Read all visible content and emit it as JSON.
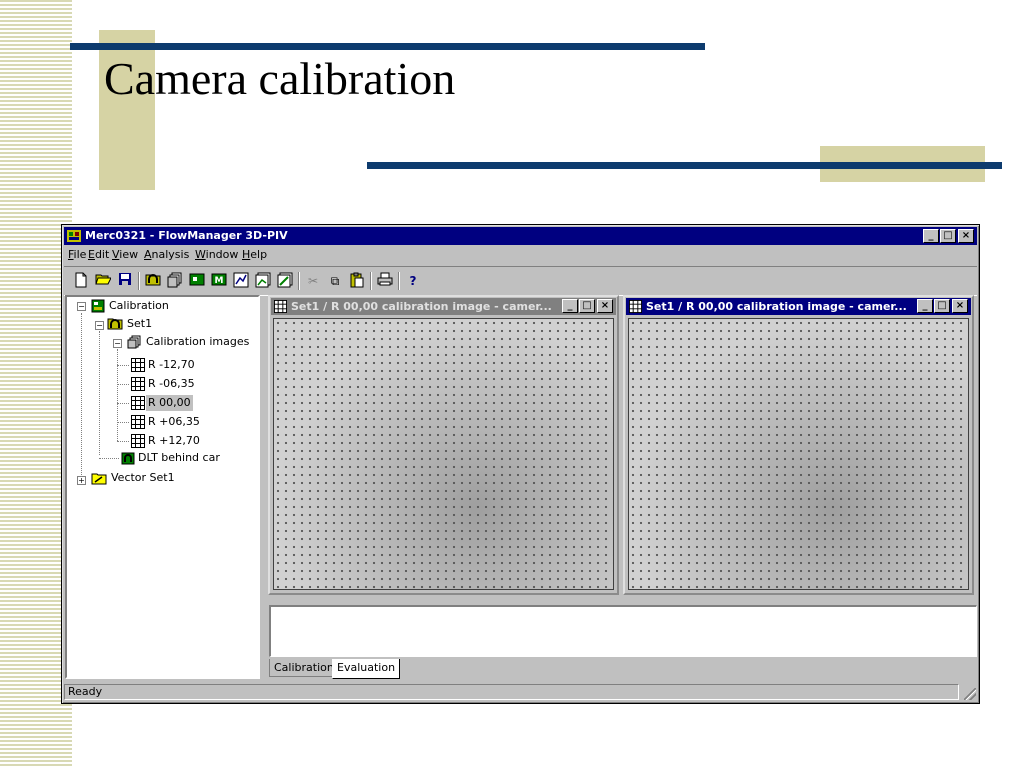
{
  "slide": {
    "title": "Camera calibration"
  },
  "window": {
    "title": "Merc0321 - FlowManager 3D-PIV",
    "caption_buttons": {
      "minimize": "_",
      "maximize": "□",
      "close": "×"
    }
  },
  "menu": [
    {
      "pre": "",
      "key": "F",
      "post": "ile"
    },
    {
      "pre": "",
      "key": "E",
      "post": "dit"
    },
    {
      "pre": "",
      "key": "V",
      "post": "iew"
    },
    {
      "pre": "",
      "key": "A",
      "post": "nalysis"
    },
    {
      "pre": "",
      "key": "W",
      "post": "indow"
    },
    {
      "pre": "",
      "key": "H",
      "post": "elp"
    }
  ],
  "toolbar": {
    "icons": [
      "new-file-icon",
      "open-folder-icon",
      "save-icon",
      "calibration-icon",
      "images-icon",
      "setup-icon",
      "m-icon",
      "stats-icon",
      "stats2-icon",
      "vector-icon",
      "cut-icon",
      "copy-icon",
      "paste-icon",
      "print-icon",
      "help-icon"
    ],
    "glyphs": {
      "cut": "✂",
      "copy": "⧉",
      "help": "?"
    }
  },
  "tree": {
    "root": "Calibration",
    "set": "Set1",
    "images_folder": "Calibration images",
    "images": [
      "R -12,70",
      "R -06,35",
      "R 00,00",
      "R +06,35",
      "R +12,70"
    ],
    "selected_index": 2,
    "dlt": "DLT behind car",
    "vector_set": "Vector Set1",
    "expand_marks": {
      "collapsed": "+",
      "expanded": "−"
    }
  },
  "child_windows": [
    {
      "title": "Set1 / R 00,00 calibration image - camer...",
      "state": "inactive"
    },
    {
      "title": "Set1 / R 00,00 calibration image - camer...",
      "state": "active"
    }
  ],
  "tabs": [
    {
      "label": "Calibration",
      "active": false
    },
    {
      "label": "Evaluation",
      "active": true
    }
  ],
  "status": {
    "text": "Ready"
  },
  "colors": {
    "title_rule": "#0d3b6e",
    "accent": "#d6d3a4",
    "titlebar_active": "#000080",
    "titlebar_inactive": "#808080",
    "window_face": "#c0c0c0"
  }
}
